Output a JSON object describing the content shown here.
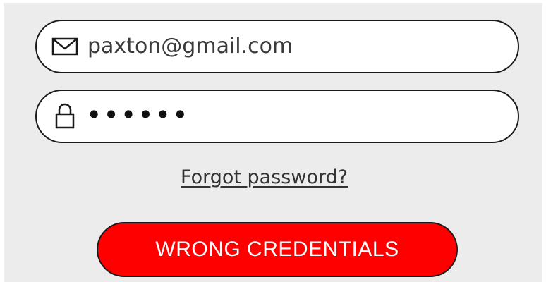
{
  "login": {
    "email": {
      "value": "paxton@gmail.com",
      "icon": "envelope-icon"
    },
    "password": {
      "masked_value": "••••••",
      "icon": "lock-icon"
    },
    "forgot_password_link": "Forgot password?",
    "submit_button_label": "WRONG CREDENTIALS"
  },
  "colors": {
    "panel_background": "#ececec",
    "field_background": "#ffffff",
    "button_background": "#ff0000",
    "button_text": "#ffffff"
  }
}
